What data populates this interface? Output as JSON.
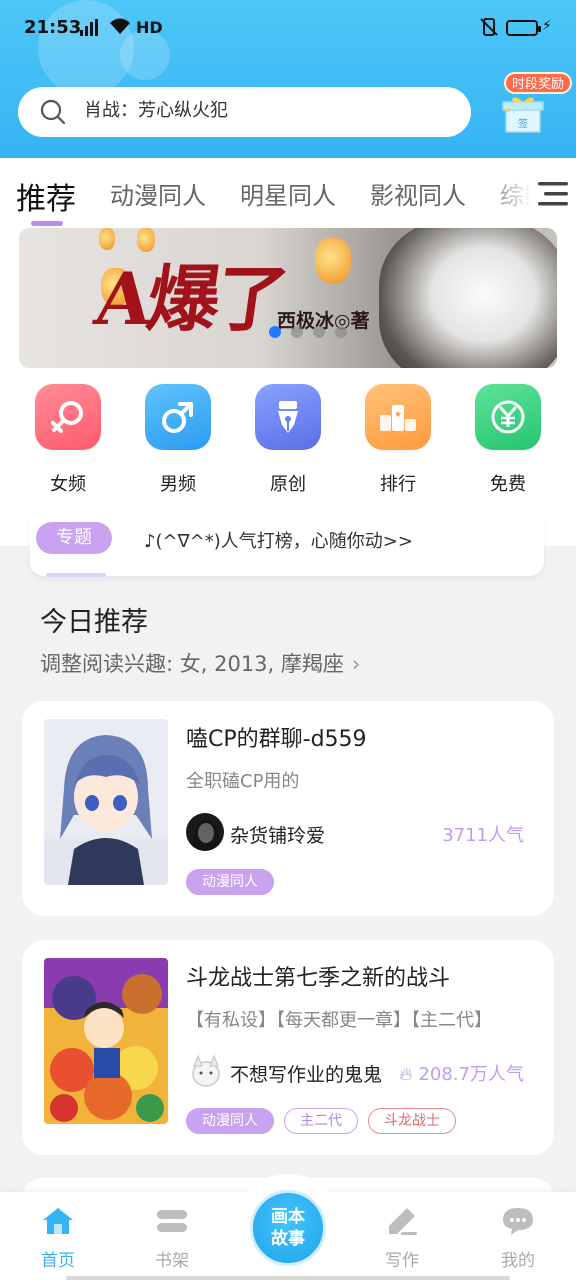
{
  "status": {
    "time": "21:53",
    "network": "4G",
    "hd": "HD"
  },
  "search": {
    "placeholder": "肖战：芳心纵火犯"
  },
  "reward": {
    "label": "时段奖励",
    "box_label": "签"
  },
  "tabs": [
    {
      "label": "推荐",
      "active": true
    },
    {
      "label": "动漫同人"
    },
    {
      "label": "明星同人"
    },
    {
      "label": "影视同人"
    },
    {
      "label": "综影"
    }
  ],
  "banner": {
    "title": "A爆了",
    "author": "西极冰◎著",
    "dots": 4,
    "active_dot": 0
  },
  "categories": [
    {
      "label": "女频",
      "icon": "female-symbol-icon",
      "color": "#ff6b7d"
    },
    {
      "label": "男频",
      "icon": "male-symbol-icon",
      "color": "#38a9f7"
    },
    {
      "label": "原创",
      "icon": "fountain-pen-icon",
      "color": "#6d85f2"
    },
    {
      "label": "排行",
      "icon": "podium-icon",
      "color": "#ffab5c"
    },
    {
      "label": "免费",
      "icon": "yuan-icon",
      "color": "#37d37f"
    }
  ],
  "topic": {
    "pill": "专题",
    "text": "♪(^∇^*)人气打榜，心随你动>>"
  },
  "section": {
    "title": "今日推荐",
    "subtitle": "调整阅读兴趣: 女, 2013, 摩羯座"
  },
  "books": [
    {
      "title": "嗑CP的群聊-d559",
      "desc": "全职磕CP用的",
      "author": "杂货铺玲爱",
      "popularity": "3711人气",
      "hot": false,
      "tags": [
        {
          "label": "动漫同人",
          "style": "fill"
        }
      ]
    },
    {
      "title": "斗龙战士第七季之新的战斗",
      "desc": "【有私设】【每天都更一章】【主二代】",
      "author": "不想写作业的鬼鬼",
      "popularity": "208.7万人气",
      "hot": true,
      "tags": [
        {
          "label": "动漫同人",
          "style": "fill"
        },
        {
          "label": "主二代",
          "style": "ol-purple"
        },
        {
          "label": "斗龙战士",
          "style": "ol-red"
        }
      ]
    }
  ],
  "nav": {
    "home": "首页",
    "shelf": "书架",
    "center_line1": "画本",
    "center_line2": "故事",
    "write": "写作",
    "mine": "我的"
  },
  "colors": {
    "header": "#36b3f4",
    "accent_purple": "#c9a3f0",
    "nav_active": "#36b3f4"
  }
}
